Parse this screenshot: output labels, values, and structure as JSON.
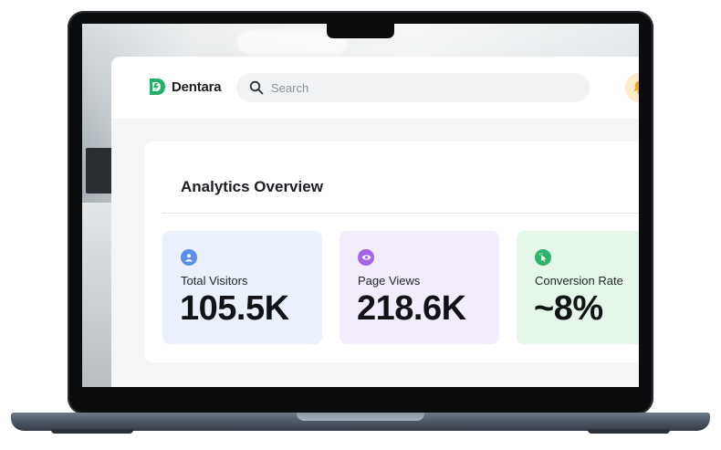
{
  "brand": {
    "name": "Dentara",
    "accent": "#22b06b"
  },
  "search": {
    "placeholder": "Search",
    "icon": "search-icon"
  },
  "header": {
    "notification_icon": "bell-icon"
  },
  "analytics": {
    "title": "Analytics Overview",
    "stats": [
      {
        "label": "Total Visitors",
        "value": "105.5K",
        "icon": "user-icon",
        "icon_color": "#5b8fe8",
        "bg": "#eaf1fd"
      },
      {
        "label": "Page Views",
        "value": "218.6K",
        "icon": "eye-icon",
        "icon_color": "#a466e8",
        "bg": "#f3ecfc"
      },
      {
        "label": "Conversion Rate",
        "value": "~8%",
        "icon": "cursor-click-icon",
        "icon_color": "#2fb36a",
        "bg": "#e4f7e9"
      }
    ]
  }
}
